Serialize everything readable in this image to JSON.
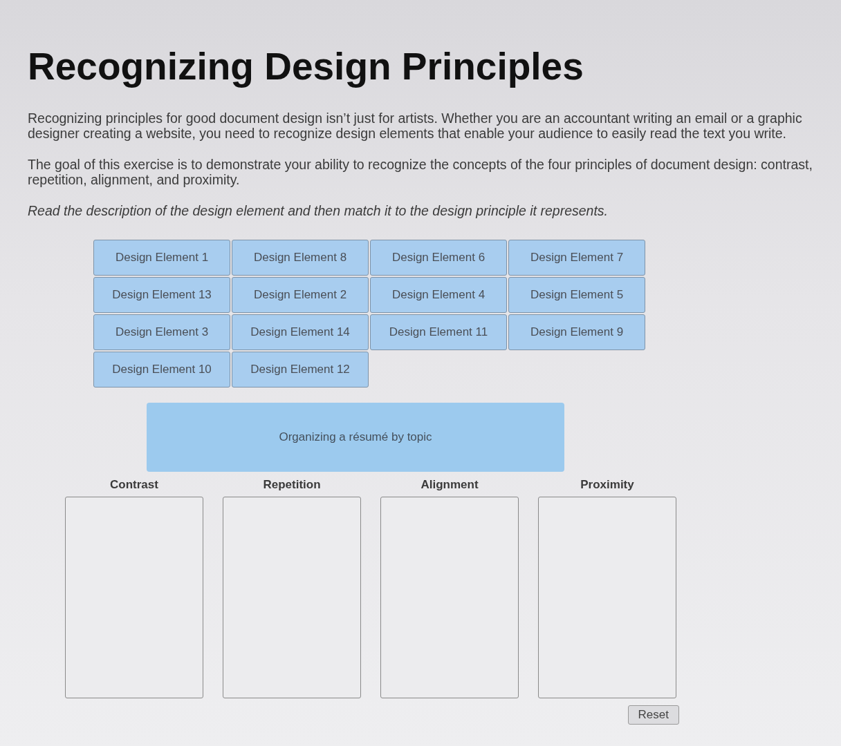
{
  "title": "Recognizing Design Principles",
  "paragraphs": [
    {
      "kind": "body",
      "text": "Recognizing principles for good document design isn’t just for artists. Whether you are an accountant writing an email or a graphic designer creating a website, you need to recognize design elements that enable your audience to easily read the text you write."
    },
    {
      "kind": "body",
      "text": "The goal of this exercise is to demonstrate your ability to recognize the concepts of the four principles of document design: contrast, repetition, alignment, and proximity."
    },
    {
      "kind": "instruction",
      "text": "Read the description of the design element and then match it to the design principle it represents."
    }
  ],
  "elements": [
    {
      "label": "Design Element 1"
    },
    {
      "label": "Design Element 8"
    },
    {
      "label": "Design Element 6"
    },
    {
      "label": "Design Element 7"
    },
    {
      "label": "Design Element 13"
    },
    {
      "label": "Design Element 2"
    },
    {
      "label": "Design Element 4"
    },
    {
      "label": "Design Element 5"
    },
    {
      "label": "Design Element 3"
    },
    {
      "label": "Design Element 14"
    },
    {
      "label": "Design Element 11"
    },
    {
      "label": "Design Element 9"
    },
    {
      "label": "Design Element 10"
    },
    {
      "label": "Design Element 12"
    }
  ],
  "description": {
    "text": "Organizing a résumé by topic"
  },
  "categories": [
    {
      "label": "Contrast"
    },
    {
      "label": "Repetition"
    },
    {
      "label": "Alignment"
    },
    {
      "label": "Proximity"
    }
  ],
  "reset": {
    "label": "Reset"
  }
}
